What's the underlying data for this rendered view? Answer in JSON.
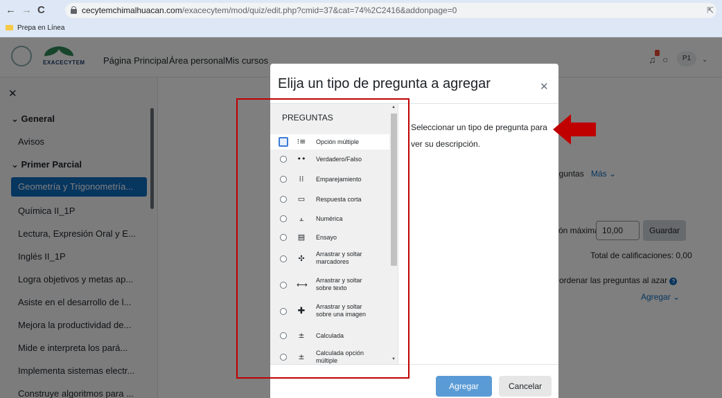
{
  "browser": {
    "url_host": "cecytemchimalhuacan.com",
    "url_path": "/exacecytem/mod/quiz/edit.php?cmid=37&cat=74%2C2416&addonpage=0",
    "bookmark": "Prepa en Línea"
  },
  "navbar": {
    "logo_text": "EXACECYTEM",
    "links": [
      "Página Principal",
      "Área personal",
      "Mis cursos"
    ],
    "avatar": "P1"
  },
  "sidebar": {
    "items": [
      {
        "label": "General",
        "type": "section"
      },
      {
        "label": "Avisos",
        "type": "item"
      },
      {
        "label": "Primer Parcial",
        "type": "section"
      },
      {
        "label": "Geometría y Trigonometría...",
        "type": "active"
      },
      {
        "label": "Química II_1P",
        "type": "item"
      },
      {
        "label": "Lectura, Expresión Oral y E...",
        "type": "item"
      },
      {
        "label": "Inglés II_1P",
        "type": "item"
      },
      {
        "label": "Logra objetivos y metas ap...",
        "type": "item"
      },
      {
        "label": "Asiste en el desarrollo de l...",
        "type": "item"
      },
      {
        "label": "Mejora la productividad de...",
        "type": "item"
      },
      {
        "label": "Mide e interpreta los pará...",
        "type": "item"
      },
      {
        "label": "Implementa sistemas electr...",
        "type": "item"
      },
      {
        "label": "Construye algoritmos para ...",
        "type": "item"
      }
    ]
  },
  "main": {
    "tab_questions_fragment": "eguntas",
    "tab_more": "Más",
    "max_grade_label": "ón máxima",
    "max_grade_value": "10,00",
    "save_button": "Guardar",
    "total_grades": "Total de calificaciones: 0,00",
    "shuffle_label": "ordenar las preguntas al azar",
    "add_dropdown": "Agregar"
  },
  "modal": {
    "title": "Elija un tipo de pregunta a agregar",
    "section_heading": "PREGUNTAS",
    "description": "Seleccionar un tipo de pregunta para ver su descripción.",
    "questions": [
      {
        "label": "Opción múltiple",
        "icon": "multichoice-icon",
        "glyph": "⁝≡",
        "selected": true
      },
      {
        "label": "Verdadero/Falso",
        "icon": "truefalse-icon",
        "glyph": "••",
        "selected": false
      },
      {
        "label": "Emparejamiento",
        "icon": "matching-icon",
        "glyph": "⁞⁞",
        "selected": false
      },
      {
        "label": "Respuesta corta",
        "icon": "shortanswer-icon",
        "glyph": "▭",
        "selected": false
      },
      {
        "label": "Numérica",
        "icon": "numerical-icon",
        "glyph": "⫠",
        "selected": false
      },
      {
        "label": "Ensayo",
        "icon": "essay-icon",
        "glyph": "▤",
        "selected": false
      },
      {
        "label": "Arrastrar y soltar marcadores",
        "icon": "drag-markers-icon",
        "glyph": "✣",
        "selected": false
      },
      {
        "label": "Arrastrar y soltar sobre texto",
        "icon": "drag-text-icon",
        "glyph": "⟷",
        "selected": false
      },
      {
        "label": "Arrastrar y soltar sobre una imagen",
        "icon": "drag-image-icon",
        "glyph": "✚",
        "selected": false
      },
      {
        "label": "Calculada",
        "icon": "calculated-icon",
        "glyph": "±",
        "selected": false
      },
      {
        "label": "Calculada opción múltiple",
        "icon": "calculated-multi-icon",
        "glyph": "±",
        "selected": false
      }
    ],
    "add_button": "Agregar",
    "cancel_button": "Cancelar"
  },
  "colors": {
    "accent": "#0f6cbf",
    "annotation_red": "#c00000",
    "add_button": "#5b9bd5"
  }
}
